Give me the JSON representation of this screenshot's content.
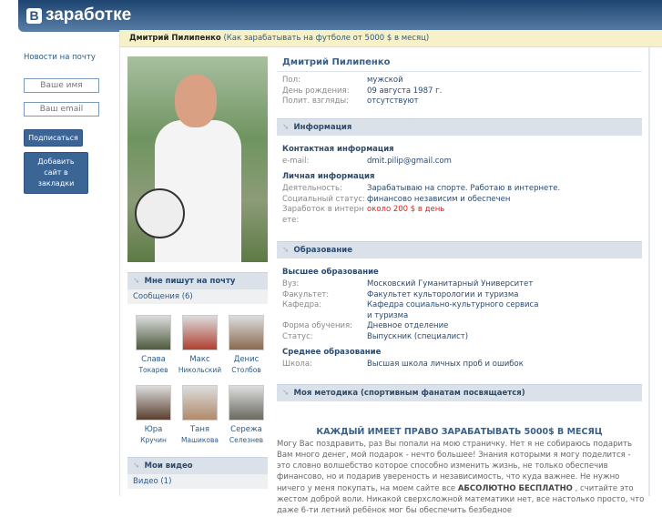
{
  "header": {
    "logo_letter": "В",
    "logo_text": "заработке"
  },
  "topbar": {
    "name": "Дмитрий Пилипенко",
    "subtitle": "(Как зарабатывать на футболе от 5000 $ в месяц)"
  },
  "sidebar": {
    "news": "Новости на почту",
    "name_placeholder": "Ваше имя",
    "email_placeholder": "Ваш email",
    "subscribe": "Подписаться",
    "bookmark": "Добавить сайт в закладки"
  },
  "mail": {
    "title": "Мне пишут на почту",
    "messages": "Сообщения (6)",
    "friends": [
      {
        "first": "Слава",
        "last": "Токарев",
        "color": "#4d5a3e"
      },
      {
        "first": "Макс",
        "last": "Никольский",
        "color": "#b04030"
      },
      {
        "first": "Денис",
        "last": "Столбов",
        "color": "#8a6a50"
      },
      {
        "first": "Юра",
        "last": "Кручин",
        "color": "#5a4030"
      },
      {
        "first": "Таня",
        "last": "Машикова",
        "color": "#b08a6a"
      },
      {
        "first": "Сережа",
        "last": "Селезнев",
        "color": "#6a6a60"
      }
    ]
  },
  "videos": {
    "title": "Мои видео",
    "count": "Видео (1)"
  },
  "profile": {
    "name": "Дмитрий Пилипенко",
    "basic": [
      {
        "k": "Пол:",
        "v": "мужской"
      },
      {
        "k": "День рождения:",
        "v": "09 августа 1987 г."
      },
      {
        "k": "Полит. взгляды:",
        "v": "отсутствуют"
      }
    ]
  },
  "info": {
    "title": "Информация",
    "contact_h": "Контактная информация",
    "email_k": "e-mail:",
    "email_v": "dmit.pilip@gmail.com",
    "personal_h": "Личная информация",
    "activity_k": "Деятельность:",
    "activity_v": "Зарабатываю на спорте. Работаю в интернете.",
    "status_k": "Социальный статус:",
    "status_v": "финансово независим и обеспечен",
    "earn_k": "Заработок в интернете:",
    "earn_v": "около 200 $ в день"
  },
  "edu": {
    "title": "Образование",
    "higher_h": "Высшее образование",
    "rows": [
      {
        "k": "Вуз:",
        "v": "Московский Гуманитарный Университет"
      },
      {
        "k": "Факультет:",
        "v": "Факультет культорологии и туризма"
      },
      {
        "k": "Кафедра:",
        "v": "Кафедра социально-культурного сервиса и туризма"
      },
      {
        "k": "Форма обучения:",
        "v": "Дневное отделение"
      },
      {
        "k": "Статус:",
        "v": "Выпускник (специалист)"
      }
    ],
    "secondary_h": "Среднее образование",
    "school_k": "Школа:",
    "school_v": "Высшая школа личных проб и ошибок"
  },
  "method": {
    "title": "Моя методика (спортивным фанатам посвящается)",
    "headline": "КАЖДЫЙ ИМЕЕТ ПРАВО ЗАРАБАТЫВАТЬ 5000$ В МЕСЯЦ",
    "p1": "Могу Вас поздравить, раз Вы попали на мою страничку. Нет я не собираюсь подарить Вам много денег, мой подарок - нечто большее! Знания которыми я могу поделится - это словно волшебство которое способно изменить жизнь, не только обеспечив финансово, но и подарив увереность и независимость, что куда важнее. Не нужно ничего у меня покупать, на моем сайте все ",
    "bold": "АБСОЛЮТНО БЕСПЛАТНО",
    "p2": " , считайте это жестом доброй воли. Никакой сверхсложной математики нет, все настолько просто, что даже 6-ти летний ребёнок мог бы обеспечить безбедное"
  }
}
